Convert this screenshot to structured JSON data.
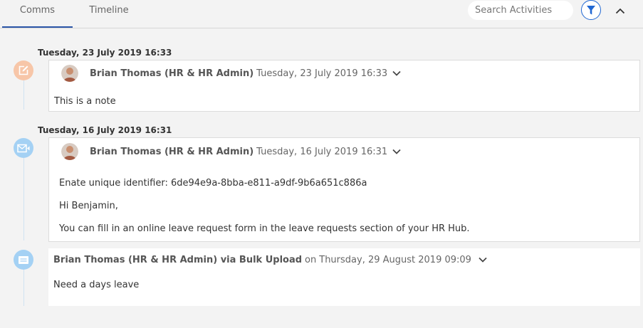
{
  "tabs": [
    {
      "label": "Comms",
      "active": true
    },
    {
      "label": "Timeline",
      "active": false
    }
  ],
  "search": {
    "placeholder": "Search Activities"
  },
  "toolbar": {
    "filter_icon": "filter-icon",
    "collapse_icon": "chevron-up-icon"
  },
  "colors": {
    "accent": "#2067d2",
    "tab_underline": "#2b56a8",
    "note_node": "#f7c6a8",
    "email_node": "#a4d1f4"
  },
  "activities": [
    {
      "date_header": "Tuesday, 23 July 2019 16:33",
      "icon": "edit-note-icon",
      "author": "Brian Thomas (HR & HR Admin)",
      "timestamp": "Tuesday, 23 July 2019 16:33",
      "lines": [
        "This is a note"
      ]
    },
    {
      "date_header": "Tuesday, 16 July 2019 16:31",
      "icon": "email-icon",
      "author": "Brian Thomas (HR & HR Admin)",
      "timestamp": "Tuesday, 16 July 2019 16:31",
      "lines": [
        "Enate unique identifier: 6de94e9a-8bba-e811-a9df-9b6a651c886a",
        "Hi Benjamin,",
        "You can fill in an online leave request form in the leave requests section of your HR Hub."
      ]
    },
    {
      "date_header": "",
      "icon": "message-icon",
      "author": "Brian Thomas (HR & HR Admin) via Bulk Upload",
      "timestamp_prefix": "on",
      "timestamp": "Thursday, 29 August 2019 09:09",
      "lines": [
        "Need a days leave"
      ]
    }
  ]
}
